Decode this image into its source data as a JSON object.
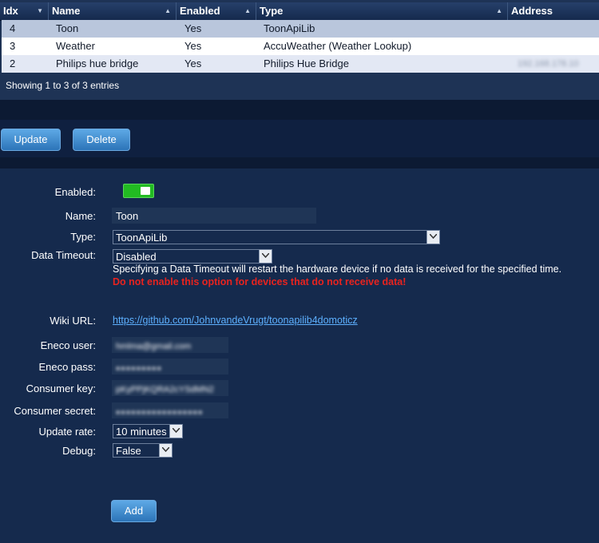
{
  "table": {
    "columns": [
      "Idx",
      "Name",
      "Enabled",
      "Type",
      "Address"
    ],
    "rows": [
      {
        "idx": "4",
        "name": "Toon",
        "enabled": "Yes",
        "type": "ToonApiLib",
        "address": ""
      },
      {
        "idx": "3",
        "name": "Weather",
        "enabled": "Yes",
        "type": "AccuWeather (Weather Lookup)",
        "address": ""
      },
      {
        "idx": "2",
        "name": "Philips hue bridge",
        "enabled": "Yes",
        "type": "Philips Hue Bridge",
        "address": "192.168.178.10"
      }
    ],
    "footer": "Showing 1 to 3 of 3 entries"
  },
  "actions": {
    "update_label": "Update",
    "delete_label": "Delete"
  },
  "form": {
    "enabled_label": "Enabled:",
    "enabled_value": true,
    "name_label": "Name:",
    "name_value": "Toon",
    "type_label": "Type:",
    "type_value": "ToonApiLib",
    "timeout_label": "Data Timeout:",
    "timeout_value": "Disabled",
    "timeout_note": "Specifying a Data Timeout will restart the hardware device if no data is received for the specified time.",
    "timeout_warning": "Do not enable this option for devices that do not receive data!",
    "wiki_label": "Wiki URL:",
    "wiki_url": "https://github.com/JohnvandeVrugt/toonapilib4domoticz",
    "eneco_user_label": "Eneco user:",
    "eneco_user_value": "hmlma@gmail.com",
    "eneco_pass_label": "Eneco pass:",
    "eneco_pass_value": "●●●●●●●●●",
    "consumer_key_label": "Consumer key:",
    "consumer_key_value": "pKyPPjKQRA2cYSdMN2",
    "consumer_secret_label": "Consumer secret:",
    "consumer_secret_value": "●●●●●●●●●●●●●●●●●",
    "update_rate_label": "Update rate:",
    "update_rate_value": "10 minutes",
    "debug_label": "Debug:",
    "debug_value": "False",
    "add_label": "Add"
  },
  "colors": {
    "accent": "#2c74b8",
    "toggle_on": "#22bb22",
    "warning": "#e8231f",
    "link": "#5db0ff"
  }
}
